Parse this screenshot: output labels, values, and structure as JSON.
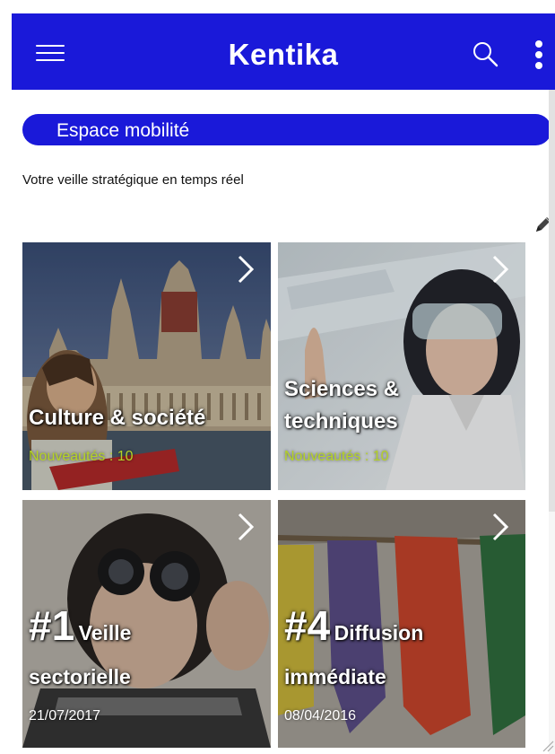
{
  "app": {
    "title": "Kentika",
    "accent_color": "#1a19d9"
  },
  "header": {
    "menu_icon": "hamburger-icon",
    "search_icon": "search-icon",
    "more_icon": "more-vertical-icon"
  },
  "section": {
    "title": "Espace mobilité",
    "subtitle": "Votre veille stratégique en temps réel",
    "edit_icon": "pencil-icon"
  },
  "tiles": [
    {
      "title": "Culture & société",
      "sub": "Nouveautés : 10",
      "sub_color": "#b5d325"
    },
    {
      "title_line1": "Sciences &",
      "title_line2": "techniques",
      "sub": "Nouveautés : 10",
      "sub_color": "#b5d325"
    },
    {
      "number": "#1",
      "word1": "Veille",
      "word2": "sectorielle",
      "date": "21/07/2017"
    },
    {
      "number": "#4",
      "word1": "Diffusion",
      "word2": "immédiate",
      "date": "08/04/2016"
    }
  ]
}
